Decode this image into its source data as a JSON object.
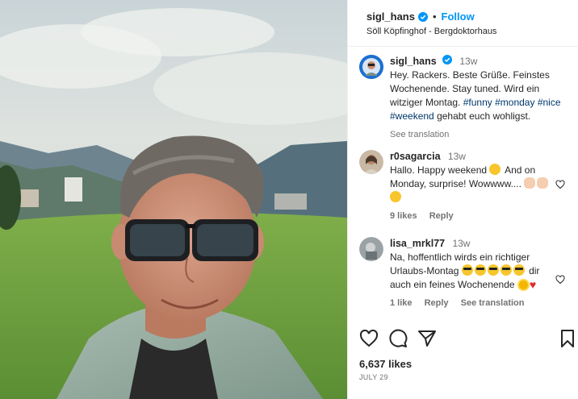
{
  "header": {
    "username": "sigl_hans",
    "separator": "•",
    "follow_label": "Follow",
    "location": "Söll Köpfinghof - Bergdoktorhaus"
  },
  "caption": {
    "username": "sigl_hans",
    "time": "13w",
    "text_plain": "Hey. Rackers. Beste Grüße. Feinstes Wochenende. Stay tuned. Wird ein witziger Montag.",
    "tag1": "#funny",
    "tag2": "#monday",
    "tag3": "#nice",
    "tag4": "#weekend",
    "text_end": "gehabt euch wohligst.",
    "see_translation": "See translation"
  },
  "comments": [
    {
      "username": "r0sagarcia",
      "time": "13w",
      "text1": "Hallo. Happy weekend",
      "text2": "And on Monday, surprise! Wowwww....",
      "likes": "9 likes",
      "reply": "Reply"
    },
    {
      "username": "lisa_mrkl77",
      "time": "13w",
      "text1": "Na, hoffentlich wirds ein richtiger Urlaubs-Montag",
      "text2": "dir auch ein feines Wochenende",
      "likes": "1 like",
      "reply": "Reply",
      "see_translation": "See translation"
    }
  ],
  "footer": {
    "likes": "6,637 likes",
    "date": "JULY 29"
  },
  "icons": {
    "like": "heart-outline-icon",
    "comment": "comment-bubble-icon",
    "share": "paper-plane-icon",
    "save": "bookmark-icon"
  },
  "colors": {
    "accent": "#0095f6",
    "hashtag": "#00376b",
    "muted": "#737373",
    "verified": "#0095f6"
  }
}
